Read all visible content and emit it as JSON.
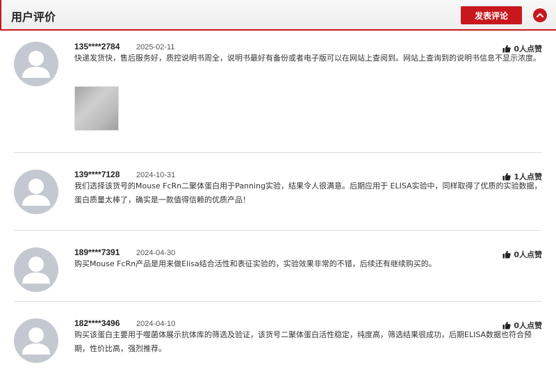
{
  "header": {
    "title": "用户评价",
    "post_label": "发表评论"
  },
  "icons": {
    "collapse": "chevron-up-icon",
    "like": "thumbs-up-icon",
    "avatar": "user-icon"
  },
  "colors": {
    "accent": "#c9171e",
    "avatar_bg": "#c4c8d0"
  },
  "reviews": [
    {
      "user": "135****2784",
      "date": "2025-02-11",
      "likes": "0人点赞",
      "text": "快递发货快，售后服务好，质控说明书周全，说明书最好有备份或者电子版可以在网站上查阅到。网站上查询到的说明书信息不显示浓度。",
      "has_photo": true
    },
    {
      "user": "139****7128",
      "date": "2024-10-31",
      "likes": "1人点赞",
      "text": "我们选择该货号的Mouse FcRn二聚体蛋白用于Panning实验，结果令人很满意。后期应用于 ELISA实验中，同样取得了优质的实验数据，蛋白质量太棒了，确实是一款值得信赖的优质产品！"
    },
    {
      "user": "189****7391",
      "date": "2024-04-30",
      "likes": "0人点赞",
      "text": "购买Mouse FcRn产品是用来做Elisa结合活性和表征实验的，实验效果非常的不错，后续还有继续购买的。"
    },
    {
      "user": "182****3496",
      "date": "2024-04-10",
      "likes": "0人点赞",
      "text": "购买该蛋白主要用于噬菌体展示抗体库的筛选及验证，该货号二聚体蛋白活性稳定，纯度高，筛选结果很成功，后期ELISA数据也符合预期，性价比高，强烈推荐。"
    }
  ]
}
